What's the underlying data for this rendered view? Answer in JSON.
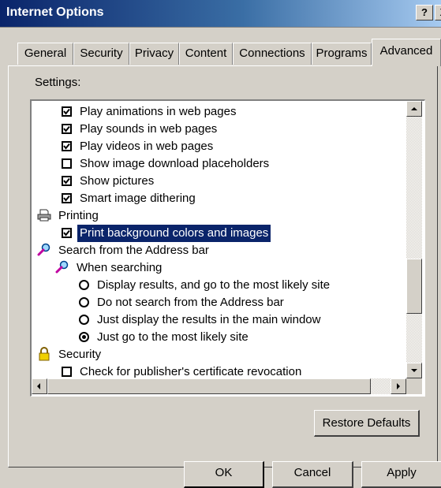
{
  "window": {
    "title": "Internet Options",
    "help_label": "?",
    "close_label": "X"
  },
  "tabs": [
    {
      "label": "General"
    },
    {
      "label": "Security"
    },
    {
      "label": "Privacy"
    },
    {
      "label": "Content"
    },
    {
      "label": "Connections"
    },
    {
      "label": "Programs"
    },
    {
      "label": "Advanced",
      "active": true
    }
  ],
  "settings": {
    "label": "Settings:",
    "rows": [
      {
        "text": "Play animations in web pages",
        "control": "checkbox",
        "checked": true
      },
      {
        "text": "Play sounds in web pages",
        "control": "checkbox",
        "checked": true
      },
      {
        "text": "Play videos in web pages",
        "control": "checkbox",
        "checked": true
      },
      {
        "text": "Show image download placeholders",
        "control": "checkbox",
        "checked": false
      },
      {
        "text": "Show pictures",
        "control": "checkbox",
        "checked": true
      },
      {
        "text": "Smart image dithering",
        "control": "checkbox",
        "checked": true
      },
      {
        "text": "Printing",
        "control": "group",
        "icon": "printer-icon"
      },
      {
        "text": "Print background colors and images",
        "control": "checkbox",
        "checked": true,
        "selected": true
      },
      {
        "text": "Search from the Address bar",
        "control": "group",
        "icon": "search-icon"
      },
      {
        "text": "When searching",
        "control": "group",
        "icon": "search-icon"
      },
      {
        "text": "Display results, and go to the most likely site",
        "control": "radio",
        "checked": false
      },
      {
        "text": "Do not search from the Address bar",
        "control": "radio",
        "checked": false
      },
      {
        "text": "Just display the results in the main window",
        "control": "radio",
        "checked": false
      },
      {
        "text": "Just go to the most likely site",
        "control": "radio",
        "checked": true
      },
      {
        "text": "Security",
        "control": "group",
        "icon": "lock-icon"
      },
      {
        "text": "Check for publisher's certificate revocation",
        "control": "checkbox",
        "checked": false
      }
    ]
  },
  "buttons": {
    "restore_defaults": "Restore Defaults",
    "ok": "OK",
    "cancel": "Cancel",
    "apply": "Apply"
  }
}
